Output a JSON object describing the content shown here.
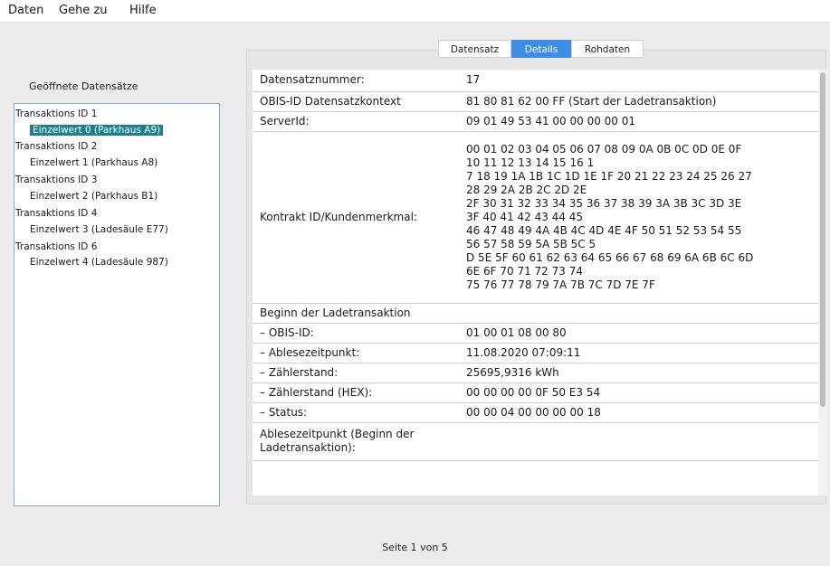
{
  "menu": {
    "items": [
      "Daten",
      "Gehe zu",
      "Hilfe"
    ]
  },
  "left": {
    "title": "Geöffnete Datensätze",
    "tree": [
      {
        "label": "Transaktions ID 1",
        "level": 0,
        "selected": false
      },
      {
        "label": "Einzelwert 0 (Parkhaus A9)",
        "level": 1,
        "selected": true
      },
      {
        "label": "Transaktions ID 2",
        "level": 0,
        "selected": false
      },
      {
        "label": "Einzelwert 1 (Parkhaus A8)",
        "level": 1,
        "selected": false
      },
      {
        "label": "Transaktions ID 3",
        "level": 0,
        "selected": false
      },
      {
        "label": "Einzelwert 2 (Parkhaus B1)",
        "level": 1,
        "selected": false
      },
      {
        "label": "Transaktions ID 4",
        "level": 0,
        "selected": false
      },
      {
        "label": "Einzelwert 3 (Ladesäule E77)",
        "level": 1,
        "selected": false
      },
      {
        "label": "Transaktions ID 6",
        "level": 0,
        "selected": false
      },
      {
        "label": "Einzelwert 4 (Ladesäule 987)",
        "level": 1,
        "selected": false
      }
    ]
  },
  "tabs": [
    {
      "label": "Datensatz",
      "active": false
    },
    {
      "label": "Details",
      "active": true
    },
    {
      "label": "Rohdaten",
      "active": false
    }
  ],
  "details": {
    "rows": [
      {
        "key": "Datensatznummer:",
        "value": [
          "17"
        ]
      },
      {
        "key": "OBIS-ID Datensatzkontext",
        "value": [
          "81 80 81 62 00 FF (Start der Ladetransaktion)"
        ]
      },
      {
        "key": "ServerId:",
        "value": [
          "09 01 49 53 41 00 00 00 00 01"
        ]
      },
      {
        "key": "Kontrakt ID/Kundenmerkmal:",
        "value": [
          "00 01 02 03 04 05 06 07 08 09 0A 0B 0C 0D 0E 0F",
          "10 11 12 13 14 15 16 1",
          "7 18 19 1A 1B 1C 1D 1E 1F 20 21 22 23 24 25 26 27",
          "28 29 2A 2B 2C 2D 2E",
          "2F 30 31 32 33 34 35 36 37 38 39 3A 3B 3C 3D 3E",
          "3F 40 41 42 43 44 45",
          "46 47 48 49 4A 4B 4C 4D 4E 4F 50 51 52 53 54 55",
          "56 57 58 59 5A 5B 5C 5",
          "D 5E 5F 60 61 62 63 64 65 66 67 68 69 6A 6B 6C 6D",
          "6E 6F 70 71 72 73 74",
          "75 76 77 78 79 7A 7B 7C 7D 7E 7F"
        ]
      },
      {
        "key": "Beginn der Ladetransaktion",
        "value": [
          ""
        ]
      },
      {
        "key": "– OBIS-ID:",
        "value": [
          "01 00 01 08 00 80"
        ]
      },
      {
        "key": "– Ablesezeitpunkt:",
        "value": [
          "11.08.2020 07:09:11"
        ]
      },
      {
        "key": "– Zählerstand:",
        "value": [
          "25695,9316 kWh"
        ]
      },
      {
        "key": "– Zählerstand (HEX):",
        "value": [
          "00 00 00 00 0F 50 E3 54"
        ]
      },
      {
        "key": "– Status:",
        "value": [
          "00 00 04 00 00 00 00 18"
        ]
      },
      {
        "key": "Ablesezeitpunkt (Beginn der Ladetransaktion):",
        "value": [
          ""
        ]
      }
    ]
  },
  "footer": {
    "page_label": "Seite 1 von 5"
  },
  "colors": {
    "selection": "#1c7f8b",
    "active_tab": "#3e8de6",
    "tree_border": "#7faad8"
  }
}
